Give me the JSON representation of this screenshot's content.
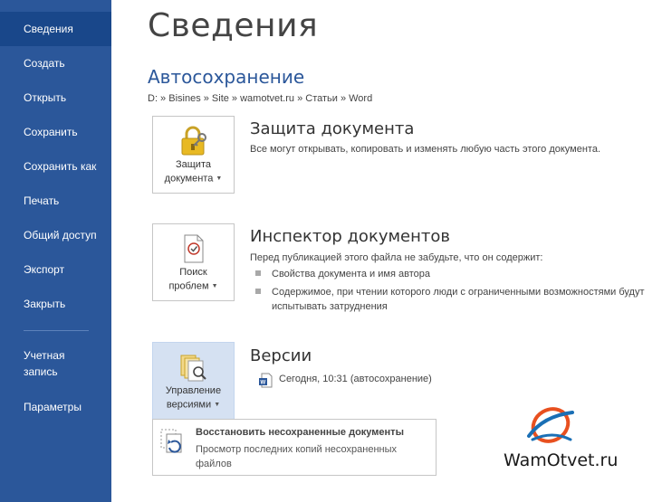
{
  "sidebar": {
    "items": [
      {
        "label": "Сведения"
      },
      {
        "label": "Создать"
      },
      {
        "label": "Открыть"
      },
      {
        "label": "Сохранить"
      },
      {
        "label": "Сохранить как"
      },
      {
        "label": "Печать"
      },
      {
        "label": "Общий доступ"
      },
      {
        "label": "Экспорт"
      },
      {
        "label": "Закрыть"
      },
      {
        "label": "Учетная запись"
      },
      {
        "label": "Параметры"
      }
    ],
    "active_index": 0,
    "background": "#2b579a"
  },
  "main": {
    "title": "Сведения",
    "document_name": "Автосохранение",
    "path": "D: » Bisines » Site » wamotvet.ru » Статьи » Word",
    "protect": {
      "button_line1": "Защита",
      "button_line2": "документа",
      "title": "Защита документа",
      "description": "Все могут открывать, копировать и изменять любую часть этого документа."
    },
    "inspect": {
      "button_line1": "Поиск",
      "button_line2": "проблем",
      "title": "Инспектор документов",
      "description": "Перед публикацией этого файла не забудьте, что он содержит:",
      "bullets": [
        "Свойства документа и имя автора",
        "Содержимое, при чтении которого люди с ограниченными возможностями будут испытывать затруднения"
      ]
    },
    "versions": {
      "button_line1": "Управление",
      "button_line2": "версиями",
      "title": "Версии",
      "entry": "Сегодня, 10:31 (автосохранение)"
    },
    "dropdown": {
      "title": "Восстановить несохраненные документы",
      "description": "Просмотр последних копий несохраненных файлов"
    }
  },
  "watermark": "WamOtvet.ru",
  "colors": {
    "accent": "#2b579a",
    "selected_tile": "#d5e1f2",
    "logo_orange": "#e8501f",
    "logo_blue": "#1a6fb5"
  }
}
